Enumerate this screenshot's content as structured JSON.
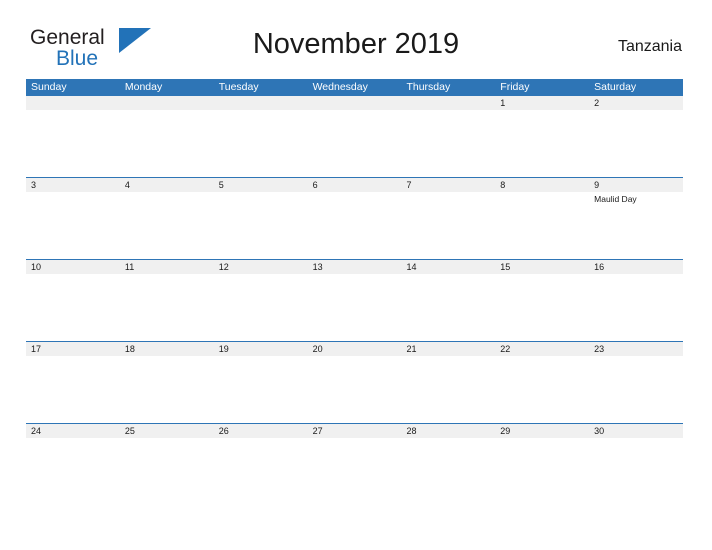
{
  "brand": {
    "name_part1": "General",
    "name_part2": "Blue",
    "flag_icon": "flag-triangle-icon",
    "blue_hex": "#2272b8"
  },
  "header": {
    "month_title": "November 2019",
    "region": "Tanzania"
  },
  "theme": {
    "header_blue": "#2e75b6",
    "row_stripe": "#f0f0f0",
    "divider_blue": "#2e75b6",
    "text_dark": "#1a1a1a"
  },
  "calendar": {
    "weekdays": [
      "Sunday",
      "Monday",
      "Tuesday",
      "Wednesday",
      "Thursday",
      "Friday",
      "Saturday"
    ],
    "weeks": [
      {
        "days": [
          {
            "date": "",
            "events": []
          },
          {
            "date": "",
            "events": []
          },
          {
            "date": "",
            "events": []
          },
          {
            "date": "",
            "events": []
          },
          {
            "date": "",
            "events": []
          },
          {
            "date": "1",
            "events": []
          },
          {
            "date": "2",
            "events": []
          }
        ]
      },
      {
        "days": [
          {
            "date": "3",
            "events": []
          },
          {
            "date": "4",
            "events": []
          },
          {
            "date": "5",
            "events": []
          },
          {
            "date": "6",
            "events": []
          },
          {
            "date": "7",
            "events": []
          },
          {
            "date": "8",
            "events": []
          },
          {
            "date": "9",
            "events": [
              "Maulid Day"
            ]
          }
        ]
      },
      {
        "days": [
          {
            "date": "10",
            "events": []
          },
          {
            "date": "11",
            "events": []
          },
          {
            "date": "12",
            "events": []
          },
          {
            "date": "13",
            "events": []
          },
          {
            "date": "14",
            "events": []
          },
          {
            "date": "15",
            "events": []
          },
          {
            "date": "16",
            "events": []
          }
        ]
      },
      {
        "days": [
          {
            "date": "17",
            "events": []
          },
          {
            "date": "18",
            "events": []
          },
          {
            "date": "19",
            "events": []
          },
          {
            "date": "20",
            "events": []
          },
          {
            "date": "21",
            "events": []
          },
          {
            "date": "22",
            "events": []
          },
          {
            "date": "23",
            "events": []
          }
        ]
      },
      {
        "days": [
          {
            "date": "24",
            "events": []
          },
          {
            "date": "25",
            "events": []
          },
          {
            "date": "26",
            "events": []
          },
          {
            "date": "27",
            "events": []
          },
          {
            "date": "28",
            "events": []
          },
          {
            "date": "29",
            "events": []
          },
          {
            "date": "30",
            "events": []
          }
        ]
      }
    ]
  }
}
